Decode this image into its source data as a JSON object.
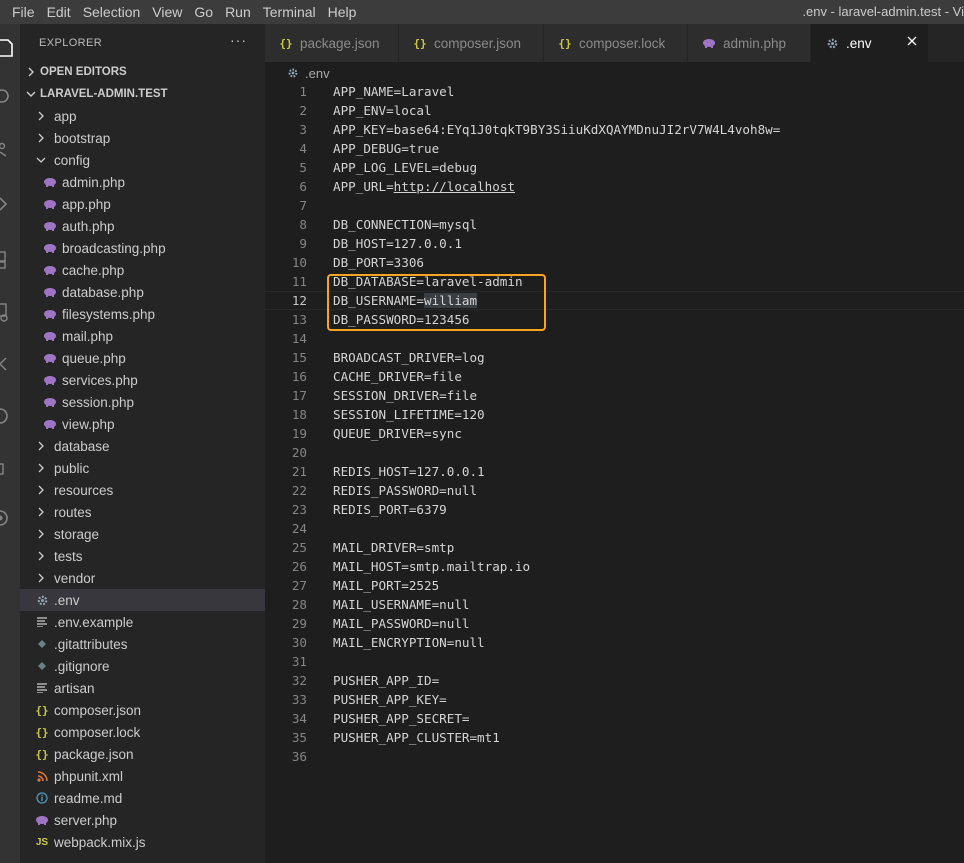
{
  "menu": [
    "File",
    "Edit",
    "Selection",
    "View",
    "Go",
    "Run",
    "Terminal",
    "Help"
  ],
  "window_title": ".env - laravel-admin.test - Vi",
  "explorer": {
    "title": "EXPLORER",
    "more": "···",
    "open_editors": "OPEN EDITORS",
    "project": "LARAVEL-ADMIN.TEST",
    "tree": [
      {
        "label": "app",
        "kind": "folder"
      },
      {
        "label": "bootstrap",
        "kind": "folder"
      },
      {
        "label": "config",
        "kind": "folder-open"
      },
      {
        "label": "admin.php",
        "kind": "php",
        "indent": 1
      },
      {
        "label": "app.php",
        "kind": "php",
        "indent": 1
      },
      {
        "label": "auth.php",
        "kind": "php",
        "indent": 1
      },
      {
        "label": "broadcasting.php",
        "kind": "php",
        "indent": 1
      },
      {
        "label": "cache.php",
        "kind": "php",
        "indent": 1
      },
      {
        "label": "database.php",
        "kind": "php",
        "indent": 1
      },
      {
        "label": "filesystems.php",
        "kind": "php",
        "indent": 1
      },
      {
        "label": "mail.php",
        "kind": "php",
        "indent": 1
      },
      {
        "label": "queue.php",
        "kind": "php",
        "indent": 1
      },
      {
        "label": "services.php",
        "kind": "php",
        "indent": 1
      },
      {
        "label": "session.php",
        "kind": "php",
        "indent": 1
      },
      {
        "label": "view.php",
        "kind": "php",
        "indent": 1
      },
      {
        "label": "database",
        "kind": "folder"
      },
      {
        "label": "public",
        "kind": "folder"
      },
      {
        "label": "resources",
        "kind": "folder"
      },
      {
        "label": "routes",
        "kind": "folder"
      },
      {
        "label": "storage",
        "kind": "folder"
      },
      {
        "label": "tests",
        "kind": "folder"
      },
      {
        "label": "vendor",
        "kind": "folder"
      },
      {
        "label": ".env",
        "kind": "gear",
        "selected": true
      },
      {
        "label": ".env.example",
        "kind": "lines"
      },
      {
        "label": ".gitattributes",
        "kind": "dot"
      },
      {
        "label": ".gitignore",
        "kind": "dot"
      },
      {
        "label": "artisan",
        "kind": "lines"
      },
      {
        "label": "composer.json",
        "kind": "json"
      },
      {
        "label": "composer.lock",
        "kind": "json"
      },
      {
        "label": "package.json",
        "kind": "json"
      },
      {
        "label": "phpunit.xml",
        "kind": "rss"
      },
      {
        "label": "readme.md",
        "kind": "info"
      },
      {
        "label": "server.php",
        "kind": "php"
      },
      {
        "label": "webpack.mix.js",
        "kind": "js"
      }
    ]
  },
  "tabs": [
    {
      "label": "package.json",
      "kind": "json"
    },
    {
      "label": "composer.json",
      "kind": "json"
    },
    {
      "label": "composer.lock",
      "kind": "json"
    },
    {
      "label": "admin.php",
      "kind": "php"
    },
    {
      "label": ".env",
      "kind": "gear",
      "active": true
    }
  ],
  "breadcrumb": ".env",
  "editor": {
    "current_line": 12,
    "lines": [
      "APP_NAME=Laravel",
      "APP_ENV=local",
      "APP_KEY=base64:EYq1J0tqkT9BY3SiiuKdXQAYMDnuJI2rV7W4L4voh8w=",
      "APP_DEBUG=true",
      "APP_LOG_LEVEL=debug",
      "APP_URL=http://localhost",
      "",
      "DB_CONNECTION=mysql",
      "DB_HOST=127.0.0.1",
      "DB_PORT=3306",
      "DB_DATABASE=laravel-admin",
      "DB_USERNAME=william",
      "DB_PASSWORD=123456",
      "",
      "BROADCAST_DRIVER=log",
      "CACHE_DRIVER=file",
      "SESSION_DRIVER=file",
      "SESSION_LIFETIME=120",
      "QUEUE_DRIVER=sync",
      "",
      "REDIS_HOST=127.0.0.1",
      "REDIS_PASSWORD=null",
      "REDIS_PORT=6379",
      "",
      "MAIL_DRIVER=smtp",
      "MAIL_HOST=smtp.mailtrap.io",
      "MAIL_PORT=2525",
      "MAIL_USERNAME=null",
      "MAIL_PASSWORD=null",
      "MAIL_ENCRYPTION=null",
      "",
      "PUSHER_APP_ID=",
      "PUSHER_APP_KEY=",
      "PUSHER_APP_SECRET=",
      "PUSHER_APP_CLUSTER=mt1",
      ""
    ]
  },
  "colors": {
    "highlight_box": "#f5a623",
    "php_icon": "#a074c4",
    "json_icon": "#cbcb41"
  }
}
